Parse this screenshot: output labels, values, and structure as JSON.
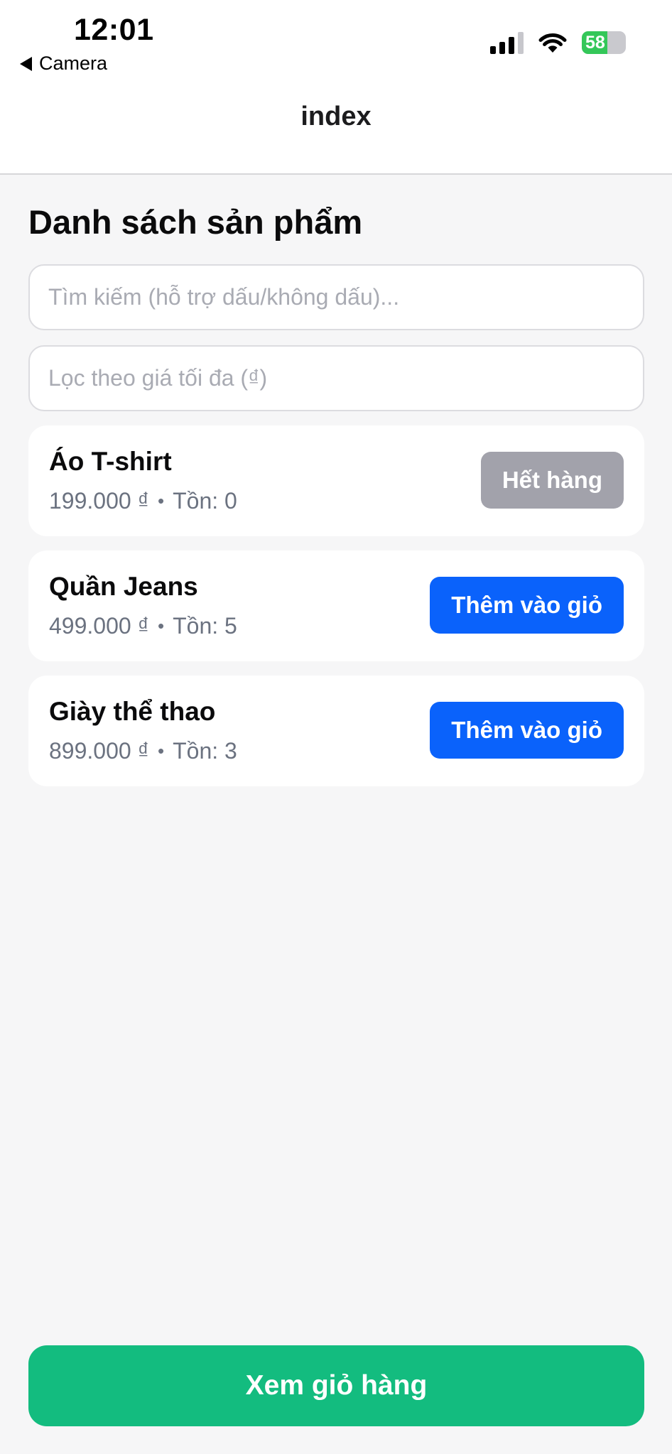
{
  "status_bar": {
    "time": "12:01",
    "back_label": "Camera",
    "battery_percent": "58",
    "battery_level": 0.58,
    "colors": {
      "battery_fill": "#34c759"
    }
  },
  "nav": {
    "title": "index"
  },
  "page": {
    "title": "Danh sách sản phẩm",
    "search_placeholder": "Tìm kiếm (hỗ trợ dấu/không dấu)...",
    "filter_placeholder": "Lọc theo giá tối đa (₫)"
  },
  "products": [
    {
      "name": "Áo T-shirt",
      "price": "199.000 ₫",
      "stock": "Tồn: 0",
      "button": "Hết hàng",
      "available": false
    },
    {
      "name": "Quần Jeans",
      "price": "499.000 ₫",
      "stock": "Tồn: 5",
      "button": "Thêm vào giỏ",
      "available": true
    },
    {
      "name": "Giày thể thao",
      "price": "899.000 ₫",
      "stock": "Tồn: 3",
      "button": "Thêm vào giỏ",
      "available": true
    }
  ],
  "footer": {
    "cart_label": "Xem giỏ hàng"
  },
  "colors": {
    "accent_blue": "#0a62fb",
    "disabled_gray": "#a2a2ab",
    "cart_green": "#13bc7f"
  }
}
